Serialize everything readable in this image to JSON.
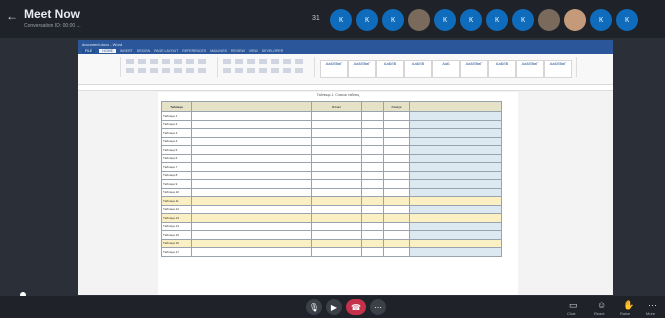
{
  "meeting": {
    "title": "Meet Now",
    "subtitle": "Conversation ID: 00:00 ...",
    "timer": "31"
  },
  "participants": [
    {
      "initials": "К",
      "type": "initials"
    },
    {
      "initials": "К",
      "type": "initials"
    },
    {
      "initials": "К",
      "type": "initials"
    },
    {
      "initials": "",
      "type": "photo"
    },
    {
      "initials": "К",
      "type": "initials"
    },
    {
      "initials": "К",
      "type": "initials"
    },
    {
      "initials": "К",
      "type": "initials"
    },
    {
      "initials": "К",
      "type": "initials"
    },
    {
      "initials": "",
      "type": "photo"
    },
    {
      "initials": "",
      "type": "warm"
    },
    {
      "initials": "К",
      "type": "initials"
    },
    {
      "initials": "К",
      "type": "initials"
    }
  ],
  "word": {
    "window_title": "document.docx - Word",
    "tabs": [
      "FILE",
      "HOME",
      "INSERT",
      "DESIGN",
      "PAGE LAYOUT",
      "REFERENCES",
      "MAILINGS",
      "REVIEW",
      "VIEW",
      "DEVELOPER"
    ],
    "active_tab": "HOME",
    "styles": [
      "АаБбВвГ",
      "АаБбВвГ",
      "АаБбВ",
      "АаБбВ",
      "АаБ",
      "АаБбВвГ",
      "АаБбВ",
      "АаБбВвГ",
      "АаБбВвГ"
    ],
    "caption": "Таблица 1. Список таблиц",
    "table": {
      "headers": [
        "Таблица",
        "",
        "Отчет",
        "",
        "Статус",
        ""
      ],
      "rows": [
        {
          "c": [
            "Таблица 1",
            "",
            "",
            "",
            "",
            ""
          ],
          "hl": false
        },
        {
          "c": [
            "Таблица 2",
            "",
            "",
            "",
            "",
            ""
          ],
          "hl": false
        },
        {
          "c": [
            "Таблица 3",
            "",
            "",
            "",
            "",
            ""
          ],
          "hl": false
        },
        {
          "c": [
            "Таблица 4",
            "",
            "",
            "",
            "",
            ""
          ],
          "hl": false
        },
        {
          "c": [
            "Таблица 5",
            "",
            "",
            "",
            "",
            ""
          ],
          "hl": false
        },
        {
          "c": [
            "Таблица 6",
            "",
            "",
            "",
            "",
            ""
          ],
          "hl": false
        },
        {
          "c": [
            "Таблица 7",
            "",
            "",
            "",
            "",
            ""
          ],
          "hl": false
        },
        {
          "c": [
            "Таблица 8",
            "",
            "",
            "",
            "",
            ""
          ],
          "hl": false
        },
        {
          "c": [
            "Таблица 9",
            "",
            "",
            "",
            "",
            ""
          ],
          "hl": false
        },
        {
          "c": [
            "Таблица 10",
            "",
            "",
            "",
            "",
            ""
          ],
          "hl": false
        },
        {
          "c": [
            "Таблица 11",
            "",
            "",
            "",
            "",
            ""
          ],
          "hl": true
        },
        {
          "c": [
            "Таблица 12",
            "",
            "",
            "",
            "",
            ""
          ],
          "hl": false
        },
        {
          "c": [
            "Таблица 13",
            "",
            "",
            "",
            "",
            ""
          ],
          "hl": true
        },
        {
          "c": [
            "Таблица 14",
            "",
            "",
            "",
            "",
            ""
          ],
          "hl": false
        },
        {
          "c": [
            "Таблица 15",
            "",
            "",
            "",
            "",
            ""
          ],
          "hl": false
        },
        {
          "c": [
            "Таблица 16",
            "",
            "",
            "",
            "",
            ""
          ],
          "hl": true
        },
        {
          "c": [
            "Таблица 17",
            "",
            "",
            "",
            "",
            ""
          ],
          "hl": false
        }
      ]
    }
  },
  "controls": {
    "chat_label": "Chat",
    "reactions_label": "React",
    "raise_label": "Raise",
    "more_label": "More"
  },
  "colors": {
    "accent": "#0f6cbd",
    "hangup": "#c4314b",
    "word_blue": "#2b579a",
    "highlight": "#fbefc4"
  }
}
